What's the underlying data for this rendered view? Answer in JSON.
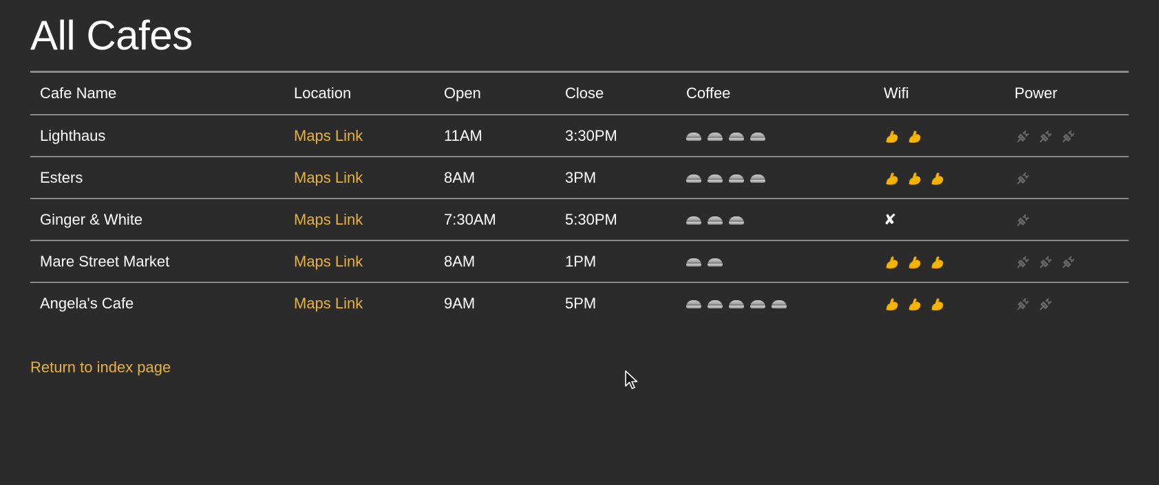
{
  "page": {
    "title": "All Cafes",
    "return_link": "Return to index page"
  },
  "colors": {
    "background": "#2b2b2b",
    "link": "#e8b23a",
    "rule": "#8a8a8a",
    "text": "#ffffff"
  },
  "table": {
    "headers": [
      "Cafe Name",
      "Location",
      "Open",
      "Close",
      "Coffee",
      "Wifi",
      "Power"
    ],
    "rows": [
      {
        "name": "Lighthaus",
        "location": "Maps Link",
        "open": "11AM",
        "close": "3:30PM",
        "coffee": 4,
        "wifi": 2,
        "power": 3
      },
      {
        "name": "Esters",
        "location": "Maps Link",
        "open": "8AM",
        "close": "3PM",
        "coffee": 4,
        "wifi": 3,
        "power": 1
      },
      {
        "name": "Ginger & White",
        "location": "Maps Link",
        "open": "7:30AM",
        "close": "5:30PM",
        "coffee": 3,
        "wifi": 0,
        "wifi_none": "✘",
        "power": 1
      },
      {
        "name": "Mare Street Market",
        "location": "Maps Link",
        "open": "8AM",
        "close": "1PM",
        "coffee": 2,
        "wifi": 3,
        "power": 3
      },
      {
        "name": "Angela's Cafe",
        "location": "Maps Link",
        "open": "9AM",
        "close": "5PM",
        "coffee": 5,
        "wifi": 3,
        "power": 2
      }
    ]
  },
  "icons": {
    "coffee": "coffee-cup-icon",
    "wifi": "flexed-arm-icon",
    "power": "power-plug-icon",
    "none": "cross-mark-icon"
  }
}
